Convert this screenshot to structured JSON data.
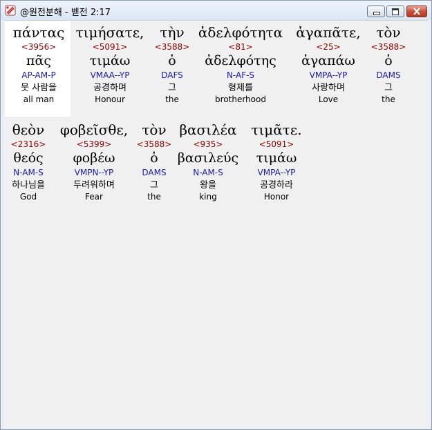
{
  "window": {
    "title": "@원전분해 - 벧전 2:17",
    "minimize_icon": "minimize-icon",
    "maximize_icon": "maximize-icon",
    "close_icon": "close-icon",
    "accent": "#c44c37"
  },
  "rows": [
    {
      "words": [
        {
          "greek": "πάντας",
          "strong": "<3956>",
          "lemma": "πᾶς",
          "morph": "AP-AM-P",
          "korean": "뭇 사람을",
          "english": "all man",
          "selected": true
        },
        {
          "greek": "τιμήσατε,",
          "strong": "<5091>",
          "lemma": "τιμάω",
          "morph": "VMAA--YP",
          "korean": "공경하며",
          "english": "Honour"
        },
        {
          "greek": "τὴν",
          "strong": "<3588>",
          "lemma": "ὁ",
          "morph": "DAFS",
          "korean": "그",
          "english": "the"
        },
        {
          "greek": "ἀδελφότητα",
          "strong": "<81>",
          "lemma": "ἀδελφότης",
          "morph": "N-AF-S",
          "korean": "형제를",
          "english": "brotherhood"
        },
        {
          "greek": "ἀγαπᾶτε,",
          "strong": "<25>",
          "lemma": "ἀγαπάω",
          "morph": "VMPA--YP",
          "korean": "사랑하며",
          "english": "Love"
        },
        {
          "greek": "τὸν",
          "strong": "<3588>",
          "lemma": "ὁ",
          "morph": "DAMS",
          "korean": "그",
          "english": "the"
        }
      ]
    },
    {
      "words": [
        {
          "greek": "θεὸν",
          "strong": "<2316>",
          "lemma": "θεός",
          "morph": "N-AM-S",
          "korean": "하나님을",
          "english": "God"
        },
        {
          "greek": "φοβεῖσθε,",
          "strong": "<5399>",
          "lemma": "φοβέω",
          "morph": "VMPN--YP",
          "korean": "두려워하며",
          "english": "Fear"
        },
        {
          "greek": "τὸν",
          "strong": "<3588>",
          "lemma": "ὁ",
          "morph": "DAMS",
          "korean": "그",
          "english": "the"
        },
        {
          "greek": "βασιλέα",
          "strong": "<935>",
          "lemma": "βασιλεύς",
          "morph": "N-AM-S",
          "korean": "왕을",
          "english": "king"
        },
        {
          "greek": "τιμᾶτε.",
          "strong": "<5091>",
          "lemma": "τιμάω",
          "morph": "VMPA--YP",
          "korean": "공경하라",
          "english": "Honor"
        }
      ]
    }
  ]
}
